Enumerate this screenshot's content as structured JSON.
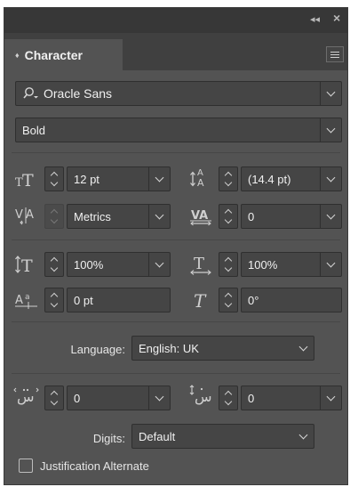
{
  "panel": {
    "tab_title": "Character",
    "collapse_glyph": "◂◂",
    "close_glyph": "×"
  },
  "font": {
    "family": "Oracle Sans",
    "style": "Bold"
  },
  "metrics": {
    "font_size": "12 pt",
    "leading": "(14.4 pt)",
    "kerning": "Metrics",
    "tracking": "0",
    "vertical_scale": "100%",
    "horizontal_scale": "100%",
    "baseline_shift": "0 pt",
    "skew": "0°"
  },
  "language": {
    "label": "Language:",
    "value": "English: UK"
  },
  "arabic": {
    "kashida": "0",
    "diacritic_pos": "0"
  },
  "digits": {
    "label": "Digits:",
    "value": "Default"
  },
  "justification_alternate": {
    "label": "Justification Alternate",
    "checked": false
  }
}
